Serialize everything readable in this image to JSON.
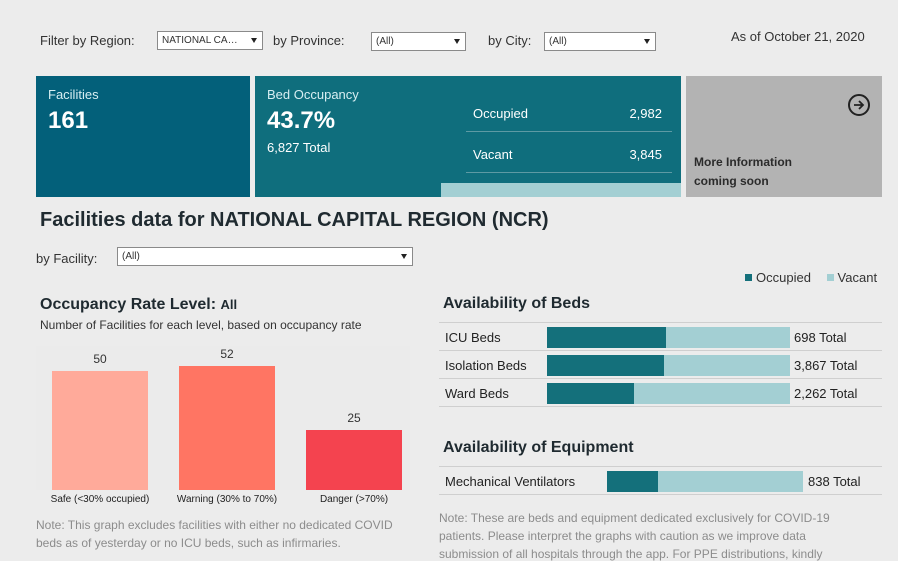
{
  "filters": {
    "region_label": "Filter by Region:",
    "region_value": "NATIONAL CA…",
    "province_label": "by Province:",
    "province_value": "(All)",
    "city_label": "by City:",
    "city_value": "(All)",
    "as_of": "As of October 21, 2020"
  },
  "kpis": {
    "facilities_label": "Facilities",
    "facilities_value": "161",
    "beds_label": "Bed Occupancy",
    "beds_rate": "43.7%",
    "beds_total": "6,827 Total",
    "occupied_label": "Occupied",
    "occupied_value": "2,982",
    "vacant_label": "Vacant",
    "vacant_value": "3,845",
    "more_info_line1": "More Information",
    "more_info_line2": "coming soon"
  },
  "region_title": "Facilities data for NATIONAL CAPITAL REGION (NCR)",
  "facility_filter": {
    "label": "by Facility:",
    "value": "(All)"
  },
  "legend": {
    "occupied": "Occupied",
    "vacant": "Vacant"
  },
  "colors": {
    "occupied": "#14707b",
    "vacant": "#a3cfd3",
    "safe": "#ffaa9a",
    "warning": "#ff7563",
    "danger": "#f4434f"
  },
  "occupancy": {
    "title": "Occupancy Rate Level:",
    "title_suffix": "All",
    "subtitle": "Number of Facilities for each level, based on occupancy rate",
    "note_line1": "Note: This graph excludes facilities with either no dedicated COVID",
    "note_line2": "beds as of yesterday or no ICU beds, such as infirmaries."
  },
  "chart_data": {
    "type": "bar",
    "categories": [
      "Safe (<30% occupied)",
      "Warning (30% to 70%)",
      "Danger (>70%)"
    ],
    "values": [
      50,
      52,
      25
    ],
    "ylim": [
      0,
      52
    ],
    "grid": false
  },
  "beds": {
    "title": "Availability of Beds",
    "rows": [
      {
        "label": "ICU Beds",
        "total": "698 Total",
        "occupied_fraction": 0.49
      },
      {
        "label": "Isolation Beds",
        "total": "3,867 Total",
        "occupied_fraction": 0.48
      },
      {
        "label": "Ward Beds",
        "total": "2,262 Total",
        "occupied_fraction": 0.36
      }
    ]
  },
  "equipment": {
    "title": "Availability of Equipment",
    "rows": [
      {
        "label": "Mechanical Ventilators",
        "total": "838 Total",
        "occupied_fraction": 0.26
      }
    ]
  },
  "right_note": {
    "line1": "Note: These are beds and equipment dedicated exclusively for COVID-19",
    "line2": "patients. Please interpret the graphs with caution as we improve data",
    "line3": "submission of all hospitals through the app. For PPE distributions, kindly"
  }
}
